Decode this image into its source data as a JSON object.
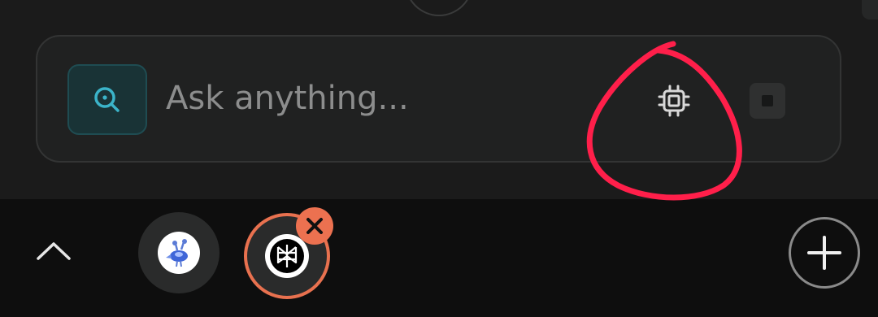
{
  "search": {
    "placeholder": "Ask anything...",
    "value": ""
  },
  "icons": {
    "search_mode": "search-icon",
    "model": "cpu-chip-icon",
    "stop": "stop-icon",
    "expand": "chevron-up-icon",
    "bubble_1": "assistant-avatar-icon",
    "bubble_2": "perplexity-logo-icon",
    "bubble_close": "close-icon",
    "add": "plus-icon"
  },
  "colors": {
    "accent": "#3bb4c9",
    "bubble_ring": "#e8714f",
    "annotation": "#ff1f4a"
  }
}
